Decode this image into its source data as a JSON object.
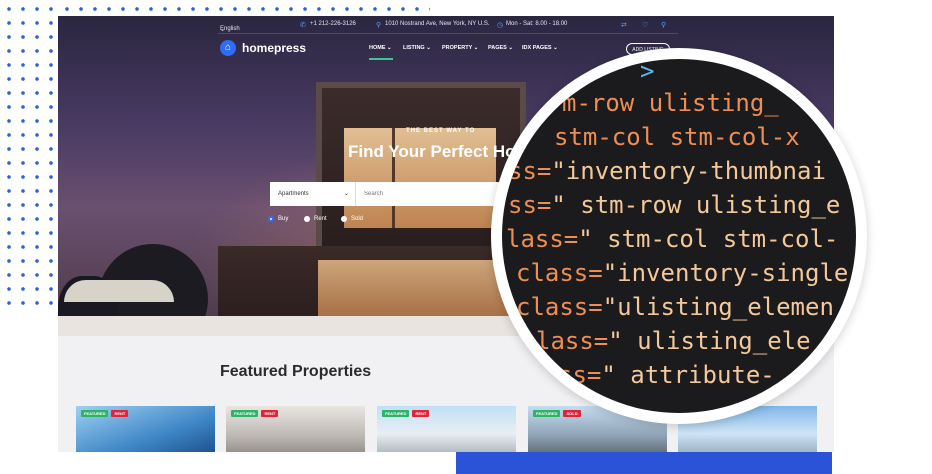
{
  "topbar": {
    "language": "English",
    "phone": "+1 212-226-3126",
    "address": "1010 Nostrand Ave, New York, NY U.S.",
    "hours": "Mon - Sat: 8.00 - 18.00"
  },
  "brand": {
    "name": "homepress"
  },
  "nav": {
    "items": [
      {
        "label": "HOME"
      },
      {
        "label": "LISTING"
      },
      {
        "label": "PROPERTY"
      },
      {
        "label": "PAGES"
      },
      {
        "label": "IDX PAGES"
      }
    ],
    "add_listing": "ADD LISTING"
  },
  "hero": {
    "kicker": "THE BEST WAY TO",
    "title": "Find Your Perfect Ho"
  },
  "search": {
    "type_selected": "Apartments",
    "placeholder": "Search"
  },
  "listing_mode": {
    "options": [
      "Buy",
      "Rent",
      "Sold"
    ],
    "selected": "Buy"
  },
  "featured": {
    "title": "Featured Properties",
    "cards": [
      {
        "badges": [
          "FEATURED",
          "RENT"
        ]
      },
      {
        "badges": [
          "FEATURED",
          "RENT"
        ]
      },
      {
        "badges": [
          "FEATURED",
          "RENT"
        ]
      },
      {
        "badges": [
          "FEATURED",
          "SOLD"
        ]
      },
      {
        "badges": []
      }
    ]
  },
  "code_zoom": {
    "lines": [
      {
        "k": "",
        "s": "",
        "p": ">"
      },
      {
        "k": "m-row  ulisting_",
        "s": "",
        "p": ""
      },
      {
        "k": "stm-col  stm-col-x",
        "s": "",
        "p": ""
      },
      {
        "k": "ss=",
        "s": "\"inventory-thumbnai",
        "p": ""
      },
      {
        "k": "ss=",
        "s": "\" stm-row ulisting_e",
        "p": ""
      },
      {
        "k": "lass=",
        "s": "\"  stm-col  stm-col-",
        "p": ""
      },
      {
        "k": "class=",
        "s": "\"inventory-single",
        "p": ""
      },
      {
        "k": "class=",
        "s": "\"ulisting_elemen",
        "p": ""
      },
      {
        "k": "lass=",
        "s": "\" ulisting_ele",
        "p": ""
      },
      {
        "k": "ss=",
        "s": "\" attribute-",
        "p": ""
      }
    ]
  }
}
